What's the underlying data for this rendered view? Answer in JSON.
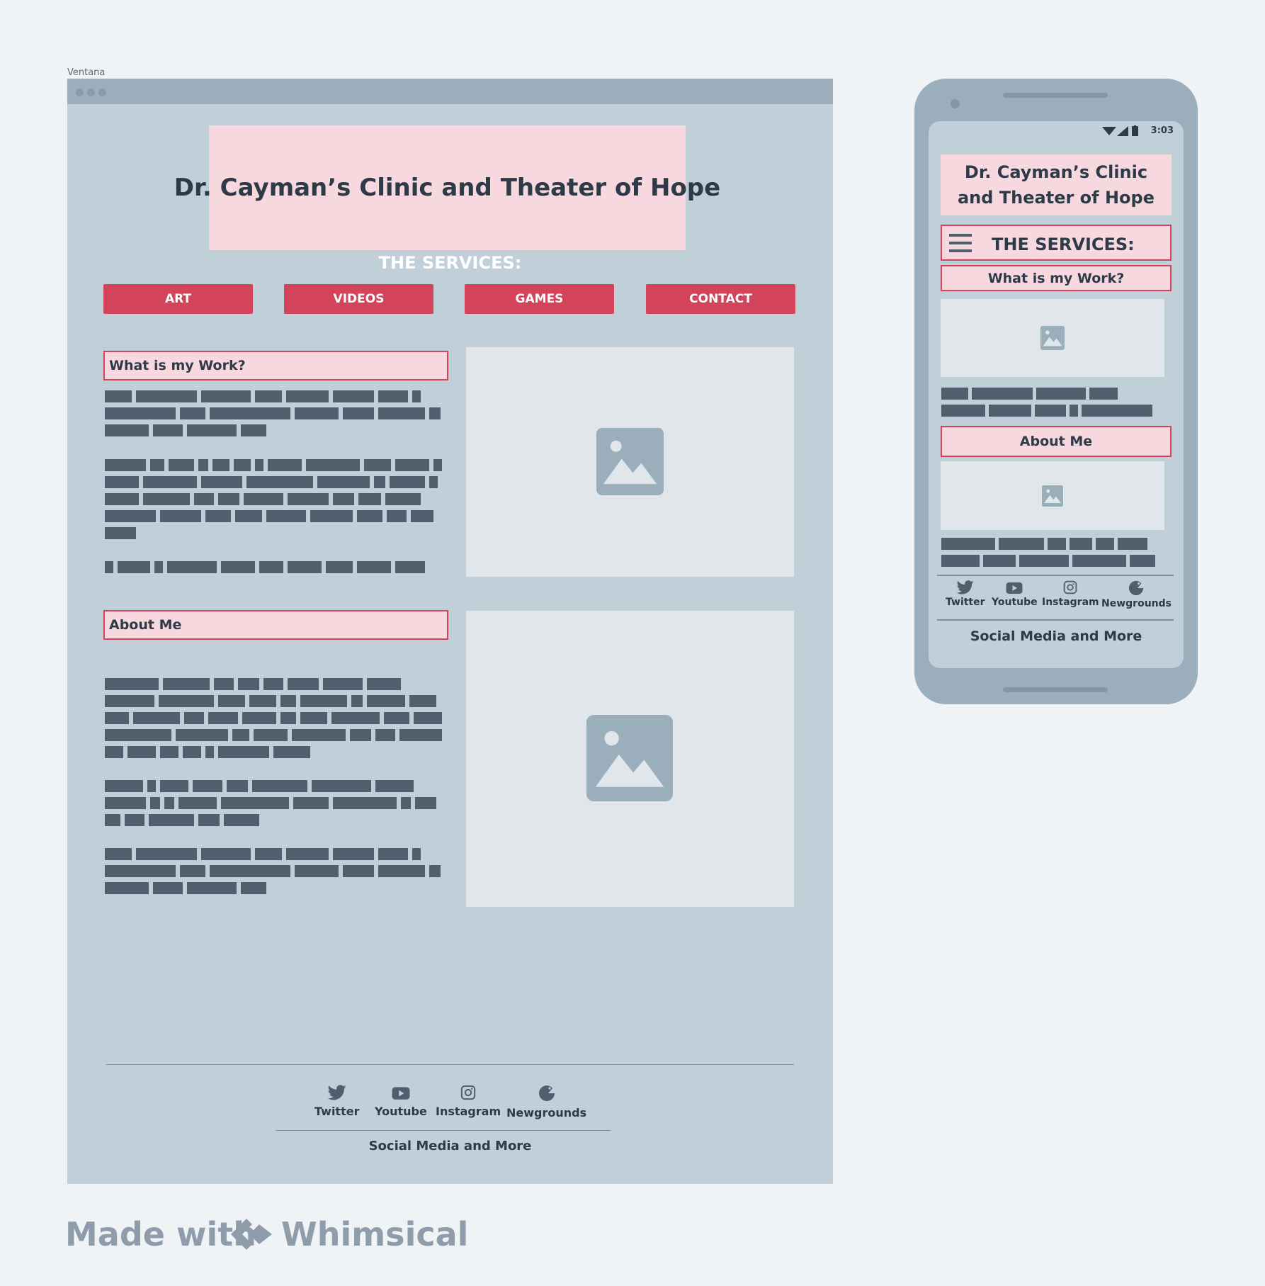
{
  "desktop": {
    "window_label": "Ventana",
    "site_title": "Dr. Cayman’s Clinic and Theater of Hope",
    "services_title": "THE SERVICES:",
    "nav": [
      "ART",
      "VIDEOS",
      "GAMES",
      "CONTACT"
    ],
    "sections": [
      {
        "heading": "What is my Work?"
      },
      {
        "heading": "About Me"
      }
    ],
    "socials": [
      "Twitter",
      "Youtube",
      "Instagram",
      "Newgrounds"
    ],
    "footer_text": "Social Media and More"
  },
  "mobile": {
    "status_time": "3:03",
    "site_title": "Dr. Cayman’s Clinic and Theater of Hope",
    "services_title": "THE SERVICES:",
    "sections": [
      {
        "heading": "What is my Work?"
      },
      {
        "heading": "About Me"
      }
    ],
    "socials": [
      "Twitter",
      "Youtube",
      "Instagram",
      "Newgrounds"
    ],
    "footer_text": "Social Media and More"
  },
  "watermark": {
    "made_with": "Made with",
    "brand": "Whimsical"
  },
  "colors": {
    "accent": "#d3435a",
    "heading_bg": "#f6d8de",
    "window_bg": "#c1cfd9",
    "text_placeholder": "#4f5f6e"
  },
  "icons": [
    "twitter-icon",
    "youtube-icon",
    "instagram-icon",
    "newgrounds-icon",
    "image-icon",
    "hamburger-menu-icon",
    "wifi-icon",
    "signal-icon",
    "battery-icon"
  ]
}
